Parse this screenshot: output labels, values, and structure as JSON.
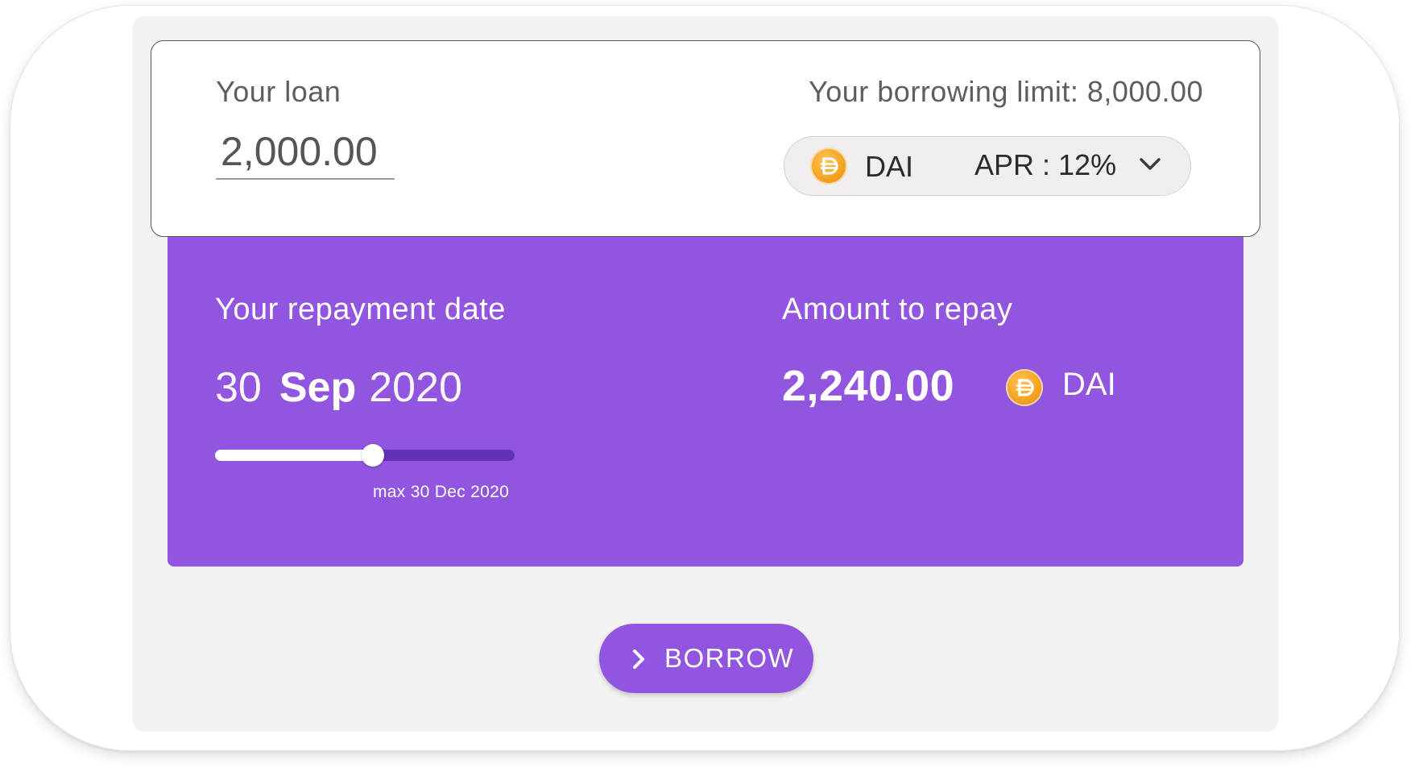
{
  "loan": {
    "label": "Your loan",
    "amount": "2,000.00",
    "limit_text": "Your borrowing limit: 8,000.00"
  },
  "token_select": {
    "icon": "dai-coin-icon",
    "token": "DAI",
    "apr_text": "APR : 12%"
  },
  "repayment": {
    "date_label": "Your repayment date",
    "date_day": "30",
    "date_month": "Sep",
    "date_year": "2020",
    "slider_fraction": 0.527,
    "slider_max_text": "max 30 Dec 2020"
  },
  "amount_to_repay": {
    "label": "Amount to repay",
    "value": "2,240.00",
    "token": "DAI"
  },
  "borrow_button": {
    "label": "BORROW",
    "icon": "chevron-right-icon"
  },
  "colors": {
    "accent": "#9155e0",
    "slider_track": "#6331b5",
    "screen_bg": "#f2f2f3",
    "coin": "#f5a623"
  }
}
